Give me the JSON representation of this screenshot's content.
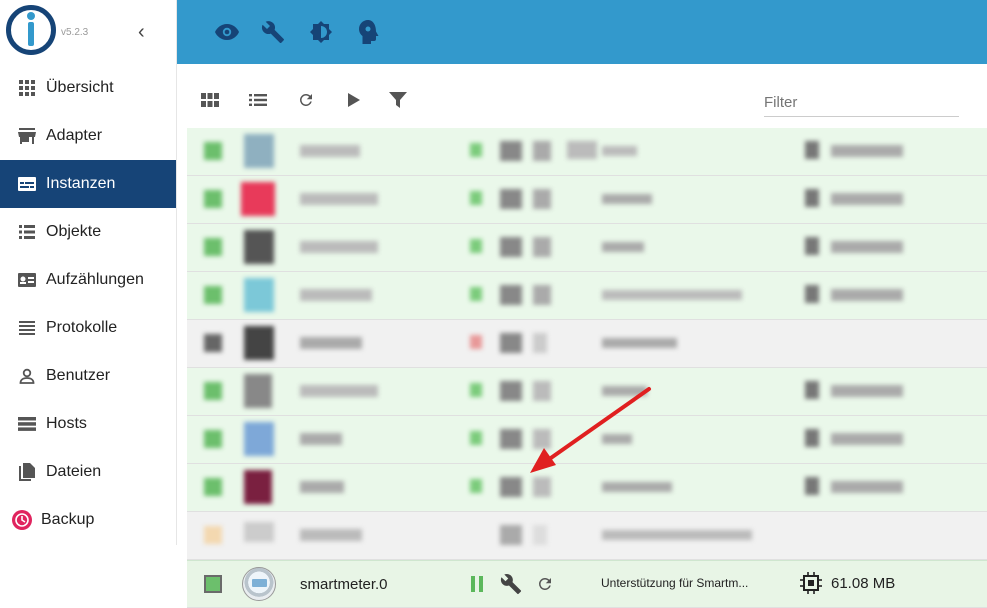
{
  "app": {
    "version": "v5.2.3",
    "colors": {
      "header": "#3399cc",
      "active": "#164477",
      "row_green": "#eaf8ea",
      "status_green": "#5cb85c",
      "arrow": "#e02020"
    }
  },
  "sidebar": {
    "items": [
      {
        "label": "Übersicht",
        "icon": "grid-icon"
      },
      {
        "label": "Adapter",
        "icon": "store-icon"
      },
      {
        "label": "Instanzen",
        "icon": "instances-icon",
        "active": true
      },
      {
        "label": "Objekte",
        "icon": "list-icon"
      },
      {
        "label": "Aufzählungen",
        "icon": "card-icon"
      },
      {
        "label": "Protokolle",
        "icon": "lines-icon"
      },
      {
        "label": "Benutzer",
        "icon": "user-icon"
      },
      {
        "label": "Hosts",
        "icon": "storage-icon"
      },
      {
        "label": "Dateien",
        "icon": "files-icon"
      },
      {
        "label": "Backup",
        "icon": "backup-icon"
      }
    ]
  },
  "header": {
    "icons": [
      "eye-icon",
      "wrench-icon",
      "brightness-icon",
      "head-icon"
    ]
  },
  "toolbar": {
    "icons": [
      "view-module-icon",
      "view-list-icon",
      "refresh-icon",
      "play-icon",
      "filter-icon"
    ],
    "filter_placeholder": "Filter"
  },
  "table": {
    "blurred_rows": 7,
    "last_row": {
      "name": "smartmeter.0",
      "title": "Unterstützung für Smartm...",
      "memory": "61.08 MB"
    }
  }
}
